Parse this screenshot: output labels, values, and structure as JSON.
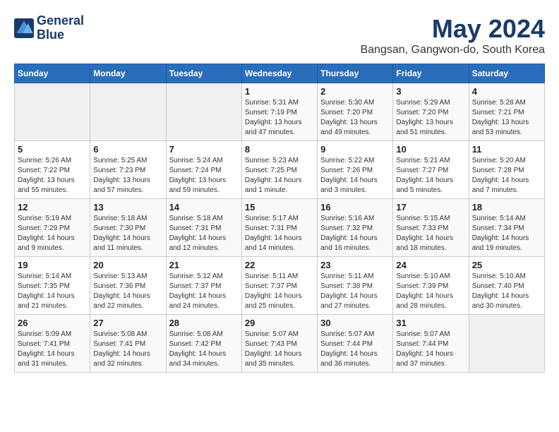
{
  "header": {
    "logo_line1": "General",
    "logo_line2": "Blue",
    "month_title": "May 2024",
    "location": "Bangsan, Gangwon-do, South Korea"
  },
  "weekdays": [
    "Sunday",
    "Monday",
    "Tuesday",
    "Wednesday",
    "Thursday",
    "Friday",
    "Saturday"
  ],
  "weeks": [
    [
      {
        "day": "",
        "info": ""
      },
      {
        "day": "",
        "info": ""
      },
      {
        "day": "",
        "info": ""
      },
      {
        "day": "1",
        "info": "Sunrise: 5:31 AM\nSunset: 7:19 PM\nDaylight: 13 hours and 47 minutes."
      },
      {
        "day": "2",
        "info": "Sunrise: 5:30 AM\nSunset: 7:20 PM\nDaylight: 13 hours and 49 minutes."
      },
      {
        "day": "3",
        "info": "Sunrise: 5:29 AM\nSunset: 7:20 PM\nDaylight: 13 hours and 51 minutes."
      },
      {
        "day": "4",
        "info": "Sunrise: 5:28 AM\nSunset: 7:21 PM\nDaylight: 13 hours and 53 minutes."
      }
    ],
    [
      {
        "day": "5",
        "info": "Sunrise: 5:26 AM\nSunset: 7:22 PM\nDaylight: 13 hours and 55 minutes."
      },
      {
        "day": "6",
        "info": "Sunrise: 5:25 AM\nSunset: 7:23 PM\nDaylight: 13 hours and 57 minutes."
      },
      {
        "day": "7",
        "info": "Sunrise: 5:24 AM\nSunset: 7:24 PM\nDaylight: 13 hours and 59 minutes."
      },
      {
        "day": "8",
        "info": "Sunrise: 5:23 AM\nSunset: 7:25 PM\nDaylight: 14 hours and 1 minute."
      },
      {
        "day": "9",
        "info": "Sunrise: 5:22 AM\nSunset: 7:26 PM\nDaylight: 14 hours and 3 minutes."
      },
      {
        "day": "10",
        "info": "Sunrise: 5:21 AM\nSunset: 7:27 PM\nDaylight: 14 hours and 5 minutes."
      },
      {
        "day": "11",
        "info": "Sunrise: 5:20 AM\nSunset: 7:28 PM\nDaylight: 14 hours and 7 minutes."
      }
    ],
    [
      {
        "day": "12",
        "info": "Sunrise: 5:19 AM\nSunset: 7:29 PM\nDaylight: 14 hours and 9 minutes."
      },
      {
        "day": "13",
        "info": "Sunrise: 5:18 AM\nSunset: 7:30 PM\nDaylight: 14 hours and 11 minutes."
      },
      {
        "day": "14",
        "info": "Sunrise: 5:18 AM\nSunset: 7:31 PM\nDaylight: 14 hours and 12 minutes."
      },
      {
        "day": "15",
        "info": "Sunrise: 5:17 AM\nSunset: 7:31 PM\nDaylight: 14 hours and 14 minutes."
      },
      {
        "day": "16",
        "info": "Sunrise: 5:16 AM\nSunset: 7:32 PM\nDaylight: 14 hours and 16 minutes."
      },
      {
        "day": "17",
        "info": "Sunrise: 5:15 AM\nSunset: 7:33 PM\nDaylight: 14 hours and 18 minutes."
      },
      {
        "day": "18",
        "info": "Sunrise: 5:14 AM\nSunset: 7:34 PM\nDaylight: 14 hours and 19 minutes."
      }
    ],
    [
      {
        "day": "19",
        "info": "Sunrise: 5:14 AM\nSunset: 7:35 PM\nDaylight: 14 hours and 21 minutes."
      },
      {
        "day": "20",
        "info": "Sunrise: 5:13 AM\nSunset: 7:36 PM\nDaylight: 14 hours and 22 minutes."
      },
      {
        "day": "21",
        "info": "Sunrise: 5:12 AM\nSunset: 7:37 PM\nDaylight: 14 hours and 24 minutes."
      },
      {
        "day": "22",
        "info": "Sunrise: 5:11 AM\nSunset: 7:37 PM\nDaylight: 14 hours and 25 minutes."
      },
      {
        "day": "23",
        "info": "Sunrise: 5:11 AM\nSunset: 7:38 PM\nDaylight: 14 hours and 27 minutes."
      },
      {
        "day": "24",
        "info": "Sunrise: 5:10 AM\nSunset: 7:39 PM\nDaylight: 14 hours and 28 minutes."
      },
      {
        "day": "25",
        "info": "Sunrise: 5:10 AM\nSunset: 7:40 PM\nDaylight: 14 hours and 30 minutes."
      }
    ],
    [
      {
        "day": "26",
        "info": "Sunrise: 5:09 AM\nSunset: 7:41 PM\nDaylight: 14 hours and 31 minutes."
      },
      {
        "day": "27",
        "info": "Sunrise: 5:08 AM\nSunset: 7:41 PM\nDaylight: 14 hours and 32 minutes."
      },
      {
        "day": "28",
        "info": "Sunrise: 5:08 AM\nSunset: 7:42 PM\nDaylight: 14 hours and 34 minutes."
      },
      {
        "day": "29",
        "info": "Sunrise: 5:07 AM\nSunset: 7:43 PM\nDaylight: 14 hours and 35 minutes."
      },
      {
        "day": "30",
        "info": "Sunrise: 5:07 AM\nSunset: 7:44 PM\nDaylight: 14 hours and 36 minutes."
      },
      {
        "day": "31",
        "info": "Sunrise: 5:07 AM\nSunset: 7:44 PM\nDaylight: 14 hours and 37 minutes."
      },
      {
        "day": "",
        "info": ""
      }
    ]
  ]
}
